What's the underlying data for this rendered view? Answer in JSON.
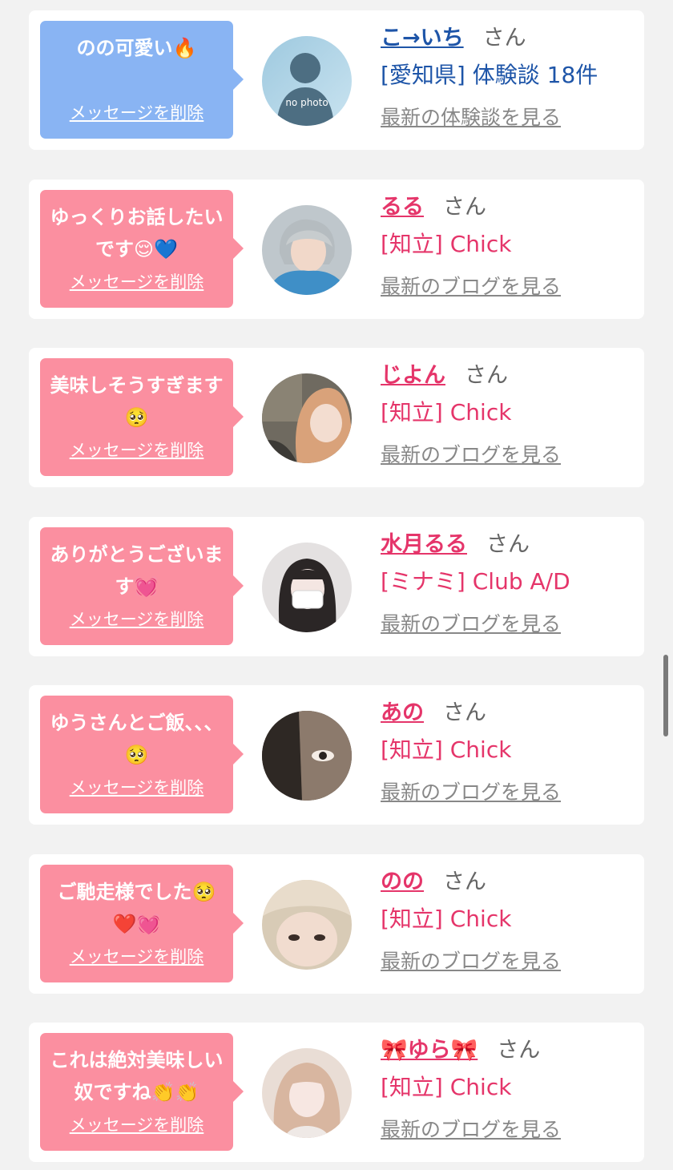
{
  "colors": {
    "background": "#f2f2f2",
    "card": "#ffffff",
    "bubble_blue": "#89b4f3",
    "bubble_pink": "#fb8fa0",
    "name_blue": "#1e55a8",
    "name_pink": "#e5356a",
    "link_gray": "#888888"
  },
  "cards": [
    {
      "bubble_color": "blue",
      "message": "のの可愛い🔥",
      "delete_label": "メッセージを削除",
      "avatar_icon": "no-photo-silhouette",
      "avatar_text": "no photo",
      "name": "こ→いち",
      "honorific": "さん",
      "shop": "[愛知県] 体験談 18件",
      "link": "最新の体験談を見る"
    },
    {
      "bubble_color": "pink",
      "message": "ゆっくりお話したいです😌💙",
      "delete_label": "メッセージを削除",
      "avatar_icon": "profile-photo",
      "name": "るる",
      "honorific": "さん",
      "shop": "[知立] Chick",
      "link": "最新のブログを見る"
    },
    {
      "bubble_color": "pink",
      "message": "美味しそうすぎます🥺",
      "delete_label": "メッセージを削除",
      "avatar_icon": "profile-photo",
      "name": "じよん",
      "honorific": "さん",
      "shop": "[知立] Chick",
      "link": "最新のブログを見る"
    },
    {
      "bubble_color": "pink",
      "message": "ありがとうございます💓",
      "delete_label": "メッセージを削除",
      "avatar_icon": "profile-photo",
      "name": "水月るる",
      "honorific": "さん",
      "shop": "[ミナミ] Club A/D",
      "link": "最新のブログを見る"
    },
    {
      "bubble_color": "pink",
      "message": "ゆうさんとご飯、、、🥺",
      "delete_label": "メッセージを削除",
      "avatar_icon": "profile-photo",
      "name": "あの",
      "honorific": "さん",
      "shop": "[知立] Chick",
      "link": "最新のブログを見る"
    },
    {
      "bubble_color": "pink",
      "message": "ご馳走様でした🥺❤️💓",
      "delete_label": "メッセージを削除",
      "avatar_icon": "profile-photo",
      "name": "のの",
      "honorific": "さん",
      "shop": "[知立] Chick",
      "link": "最新のブログを見る"
    },
    {
      "bubble_color": "pink",
      "message": "これは絶対美味しい奴ですね👏👏",
      "delete_label": "メッセージを削除",
      "avatar_icon": "profile-photo",
      "name": "🎀ゆら🎀",
      "honorific": "さん",
      "shop": "[知立] Chick",
      "link": "最新のブログを見る"
    }
  ]
}
